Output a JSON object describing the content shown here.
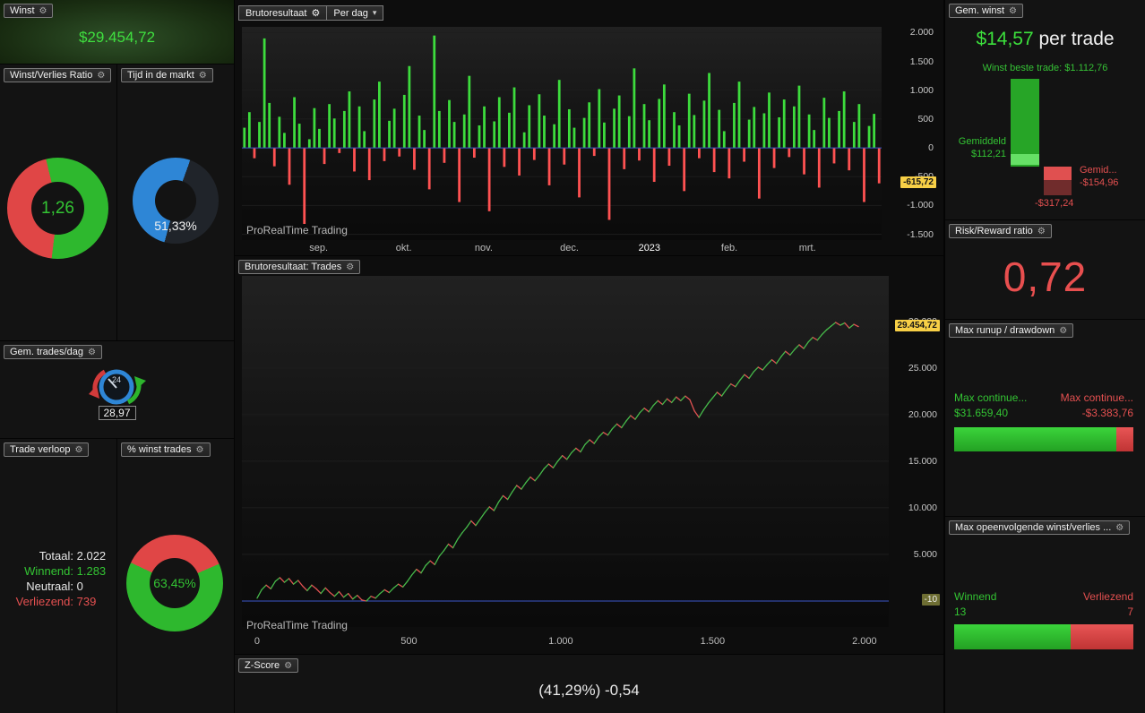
{
  "app": {
    "watermark": "ProRealTime Trading"
  },
  "colors": {
    "green": "#2eb82e",
    "red": "#e04646",
    "blue": "#2e86d6",
    "badge": "#f7cf46"
  },
  "left": {
    "winst": {
      "title": "Winst",
      "value": "$29.454,72"
    },
    "wl_ratio": {
      "title": "Winst/Verlies Ratio",
      "value": "1,26",
      "green_pct": 55.7
    },
    "tijd": {
      "title": "Tijd in de markt",
      "value": "51,33%",
      "pct": 51.33
    },
    "trades_day": {
      "title": "Gem. trades/dag",
      "value": "28,97",
      "gauge_label": "24"
    },
    "verloop": {
      "title": "Trade verloop",
      "rows": [
        {
          "label": "Totaal:",
          "value": "2.022"
        },
        {
          "label": "Winnend:",
          "value": "1.283"
        },
        {
          "label": "Neutraal:",
          "value": "0"
        },
        {
          "label": "Verliezend:",
          "value": "739"
        }
      ]
    },
    "pct_winst": {
      "title": "% winst trades",
      "value": "63,45%",
      "pct": 63.45
    }
  },
  "center": {
    "bar_header": {
      "title": "Brutoresultaat",
      "dropdown": "Per dag"
    },
    "trades_header": {
      "title": "Brutoresultaat: Trades"
    },
    "zscore": {
      "title": "Z-Score",
      "value": "(41,29%) -0,54"
    }
  },
  "right": {
    "gem_winst": {
      "title": "Gem. winst",
      "amount": "$14,57",
      "suffix": " per trade",
      "best": "Winst beste trade: $1.112,76",
      "avg_win_label": "Gemiddeld",
      "avg_win": "$112,21",
      "avg_loss_label": "Gemid...",
      "avg_loss": "-$154,96",
      "worst": "-$317,24"
    },
    "risk_reward": {
      "title": "Risk/Reward ratio",
      "value": "0,72"
    },
    "runup": {
      "title": "Max runup / drawdown",
      "win_label": "Max continue...",
      "win_value": "$31.659,40",
      "loss_label": "Max continue...",
      "loss_value": "-$3.383,76",
      "green_pct": 90.3
    },
    "streak": {
      "title": "Max opeenvolgende winst/verlies ...",
      "win_label": "Winnend",
      "win_value": "13",
      "loss_label": "Verliezend",
      "loss_value": "7",
      "green_pct": 65
    }
  },
  "chart_data": [
    {
      "type": "bar",
      "title": "Brutoresultaat per dag",
      "ylim": [
        -1600,
        2100
      ],
      "zero_line_color": "#3a57c9",
      "colors": {
        "pos": "#3ddc3d",
        "neg": "#ff5252"
      },
      "y_ticks": [
        {
          "label": "2.000",
          "value": 2000
        },
        {
          "label": "1.500",
          "value": 1500
        },
        {
          "label": "1.000",
          "value": 1000
        },
        {
          "label": "500",
          "value": 500
        },
        {
          "label": "0",
          "value": 0
        },
        {
          "label": "-500",
          "value": -500
        },
        {
          "label": "-1.000",
          "value": -1000
        },
        {
          "label": "-1.500",
          "value": -1500
        }
      ],
      "badge": {
        "label": "-615,72",
        "value": -615.72
      },
      "x_ticks": [
        {
          "label": "sep.",
          "f": 0.12
        },
        {
          "label": "okt.",
          "f": 0.253
        },
        {
          "label": "nov.",
          "f": 0.378
        },
        {
          "label": "dec.",
          "f": 0.512
        },
        {
          "label": "2023",
          "f": 0.637,
          "strong": true
        },
        {
          "label": "feb.",
          "f": 0.762
        },
        {
          "label": "mrt.",
          "f": 0.884
        }
      ],
      "values": [
        350,
        620,
        -180,
        450,
        1900,
        780,
        -320,
        540,
        260,
        -640,
        880,
        420,
        -1320,
        150,
        690,
        330,
        -280,
        760,
        510,
        -90,
        640,
        980,
        -410,
        720,
        290,
        -560,
        840,
        1150,
        -230,
        470,
        680,
        -150,
        920,
        1420,
        -380,
        560,
        310,
        -720,
        1950,
        640,
        -260,
        830,
        450,
        -940,
        580,
        1250,
        -170,
        390,
        720,
        -1100,
        460,
        880,
        -330,
        610,
        1050,
        -480,
        270,
        740,
        -210,
        930,
        560,
        -650,
        410,
        1180,
        -290,
        670,
        350,
        -860,
        520,
        790,
        -140,
        1020,
        440,
        -1250,
        680,
        910,
        -370,
        550,
        1380,
        -220,
        760,
        480,
        -590,
        850,
        1100,
        -310,
        620,
        390,
        -750,
        940,
        570,
        -180,
        820,
        1300,
        -420,
        660,
        290,
        -530,
        780,
        1150,
        -240,
        490,
        710,
        -880,
        600,
        960,
        -350,
        530,
        840,
        -160,
        720,
        1080,
        -460,
        580,
        310,
        -690,
        870,
        520,
        -270,
        640,
        980,
        -390,
        450,
        760,
        -940,
        380,
        590,
        -615.72
      ]
    },
    {
      "type": "line",
      "title": "Brutoresultaat: Trades",
      "ylim": [
        -2800,
        34900
      ],
      "xlim": [
        -50,
        2080
      ],
      "colors": {
        "up": "#46b94a",
        "down": "#e05252"
      },
      "y_ticks": [
        {
          "label": "30.000",
          "value": 30000
        },
        {
          "label": "25.000",
          "value": 25000
        },
        {
          "label": "20.000",
          "value": 20000
        },
        {
          "label": "15.000",
          "value": 15000
        },
        {
          "label": "10.000",
          "value": 10000
        },
        {
          "label": "5.000",
          "value": 5000
        }
      ],
      "x_ticks": [
        {
          "label": "0",
          "value": 0
        },
        {
          "label": "500",
          "value": 500
        },
        {
          "label": "1.000",
          "value": 1000
        },
        {
          "label": "1.500",
          "value": 1500
        },
        {
          "label": "2.000",
          "value": 2000
        }
      ],
      "badge": {
        "label": "29.454,72",
        "value": 29454.72
      },
      "min_line": {
        "label": "-10",
        "value": -10
      },
      "points": [
        [
          0,
          300
        ],
        [
          15,
          1200
        ],
        [
          30,
          1700
        ],
        [
          45,
          1300
        ],
        [
          60,
          2100
        ],
        [
          75,
          2500
        ],
        [
          90,
          2000
        ],
        [
          105,
          2400
        ],
        [
          120,
          1800
        ],
        [
          135,
          2200
        ],
        [
          150,
          1600
        ],
        [
          165,
          1100
        ],
        [
          180,
          1700
        ],
        [
          195,
          1300
        ],
        [
          210,
          800
        ],
        [
          225,
          1400
        ],
        [
          240,
          900
        ],
        [
          255,
          500
        ],
        [
          270,
          1000
        ],
        [
          285,
          400
        ],
        [
          300,
          800
        ],
        [
          315,
          200
        ],
        [
          330,
          600
        ],
        [
          345,
          100
        ],
        [
          360,
          -10
        ],
        [
          375,
          500
        ],
        [
          390,
          300
        ],
        [
          405,
          800
        ],
        [
          420,
          1200
        ],
        [
          435,
          900
        ],
        [
          450,
          1400
        ],
        [
          465,
          1800
        ],
        [
          480,
          1500
        ],
        [
          495,
          2100
        ],
        [
          510,
          2800
        ],
        [
          525,
          3400
        ],
        [
          540,
          3000
        ],
        [
          555,
          3800
        ],
        [
          570,
          4300
        ],
        [
          585,
          3900
        ],
        [
          600,
          4800
        ],
        [
          615,
          5400
        ],
        [
          630,
          6100
        ],
        [
          645,
          5700
        ],
        [
          660,
          6600
        ],
        [
          675,
          7300
        ],
        [
          690,
          7900
        ],
        [
          705,
          8600
        ],
        [
          720,
          8100
        ],
        [
          735,
          8800
        ],
        [
          750,
          9500
        ],
        [
          765,
          10100
        ],
        [
          780,
          9700
        ],
        [
          795,
          10600
        ],
        [
          810,
          11300
        ],
        [
          825,
          10900
        ],
        [
          840,
          11700
        ],
        [
          855,
          12400
        ],
        [
          870,
          12000
        ],
        [
          885,
          12700
        ],
        [
          900,
          13300
        ],
        [
          915,
          12900
        ],
        [
          930,
          13500
        ],
        [
          945,
          14200
        ],
        [
          960,
          14700
        ],
        [
          975,
          14300
        ],
        [
          990,
          15000
        ],
        [
          1005,
          15600
        ],
        [
          1020,
          15200
        ],
        [
          1035,
          15900
        ],
        [
          1050,
          16400
        ],
        [
          1065,
          16000
        ],
        [
          1080,
          16800
        ],
        [
          1095,
          17300
        ],
        [
          1110,
          16900
        ],
        [
          1125,
          17600
        ],
        [
          1140,
          18100
        ],
        [
          1155,
          17800
        ],
        [
          1170,
          18500
        ],
        [
          1185,
          19000
        ],
        [
          1200,
          18600
        ],
        [
          1215,
          19300
        ],
        [
          1230,
          19900
        ],
        [
          1245,
          19500
        ],
        [
          1260,
          20200
        ],
        [
          1275,
          20700
        ],
        [
          1290,
          20300
        ],
        [
          1305,
          21000
        ],
        [
          1320,
          21500
        ],
        [
          1335,
          21100
        ],
        [
          1350,
          21700
        ],
        [
          1365,
          21300
        ],
        [
          1380,
          21900
        ],
        [
          1395,
          21500
        ],
        [
          1410,
          22000
        ],
        [
          1425,
          21600
        ],
        [
          1440,
          20400
        ],
        [
          1455,
          19700
        ],
        [
          1470,
          20500
        ],
        [
          1485,
          21200
        ],
        [
          1500,
          21800
        ],
        [
          1515,
          22400
        ],
        [
          1530,
          22000
        ],
        [
          1545,
          22700
        ],
        [
          1560,
          23300
        ],
        [
          1575,
          23000
        ],
        [
          1590,
          23700
        ],
        [
          1605,
          24300
        ],
        [
          1620,
          23900
        ],
        [
          1635,
          24600
        ],
        [
          1650,
          25100
        ],
        [
          1665,
          24800
        ],
        [
          1680,
          25400
        ],
        [
          1695,
          25900
        ],
        [
          1710,
          25500
        ],
        [
          1725,
          26200
        ],
        [
          1740,
          26800
        ],
        [
          1755,
          26400
        ],
        [
          1770,
          27000
        ],
        [
          1785,
          27500
        ],
        [
          1800,
          27100
        ],
        [
          1815,
          27800
        ],
        [
          1830,
          28300
        ],
        [
          1845,
          28000
        ],
        [
          1860,
          28600
        ],
        [
          1875,
          29100
        ],
        [
          1890,
          29500
        ],
        [
          1905,
          29900
        ],
        [
          1920,
          29600
        ],
        [
          1935,
          29850
        ],
        [
          1950,
          29300
        ],
        [
          1965,
          29700
        ],
        [
          1980,
          29454.72
        ]
      ]
    }
  ]
}
